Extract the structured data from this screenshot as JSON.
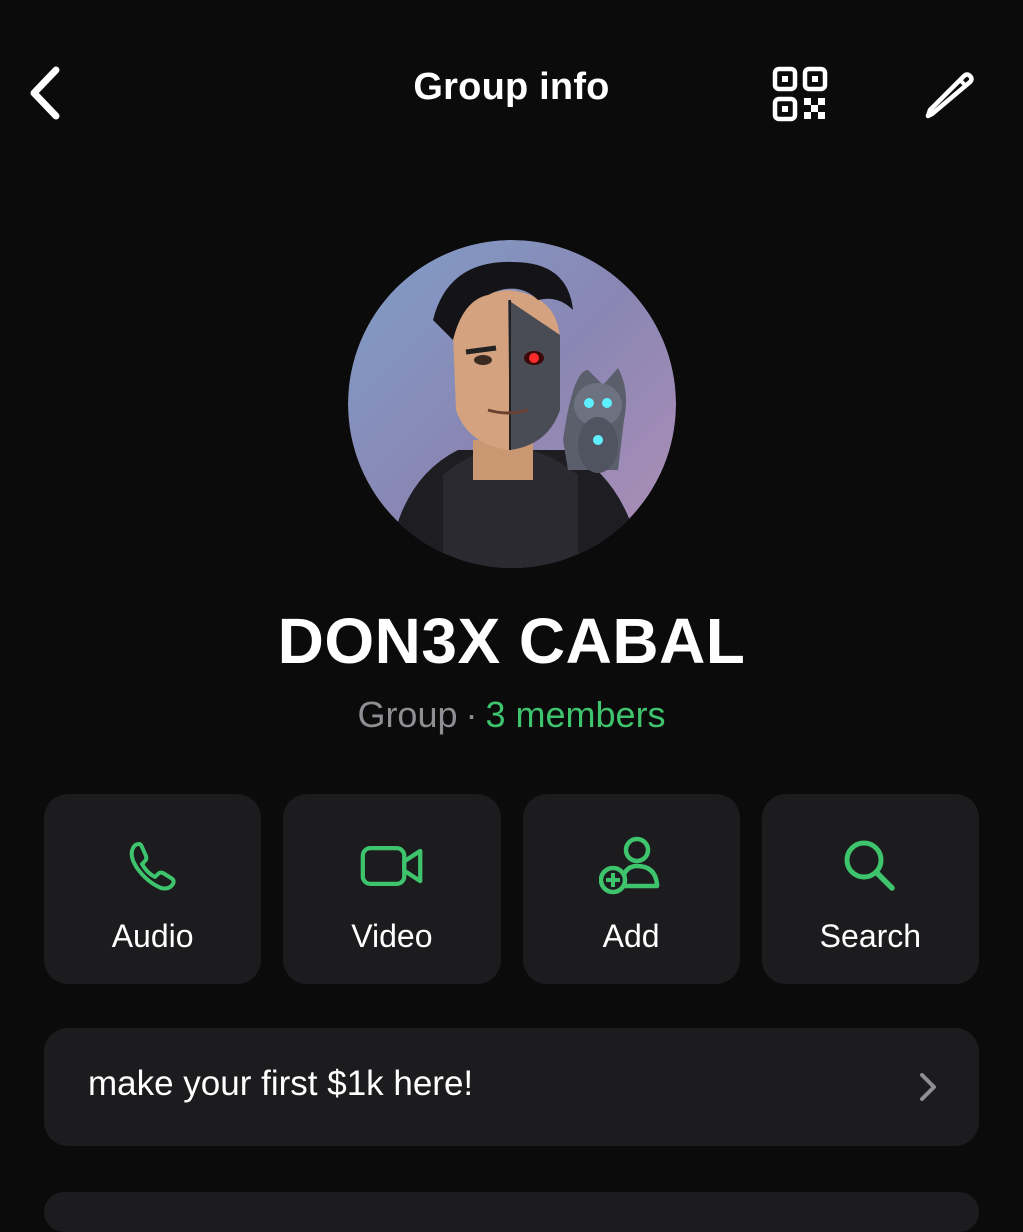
{
  "header": {
    "title": "Group info",
    "back_icon": "chevron-left-icon",
    "qr_icon": "qr-code-icon",
    "edit_icon": "pencil-icon"
  },
  "group": {
    "name": "DON3X CABAL",
    "type": "Group",
    "separator": "·",
    "members": "3 members"
  },
  "actions": [
    {
      "label": "Audio",
      "icon": "phone-icon"
    },
    {
      "label": "Video",
      "icon": "video-camera-icon"
    },
    {
      "label": "Add",
      "icon": "add-person-icon"
    },
    {
      "label": "Search",
      "icon": "search-icon"
    }
  ],
  "description": {
    "text": "make your first $1k here!",
    "chevron_icon": "chevron-right-icon"
  },
  "colors": {
    "background": "#0b0b0b",
    "card": "#1c1c1e",
    "accent_green": "#3ec46d",
    "secondary_text": "#8e8e93"
  }
}
